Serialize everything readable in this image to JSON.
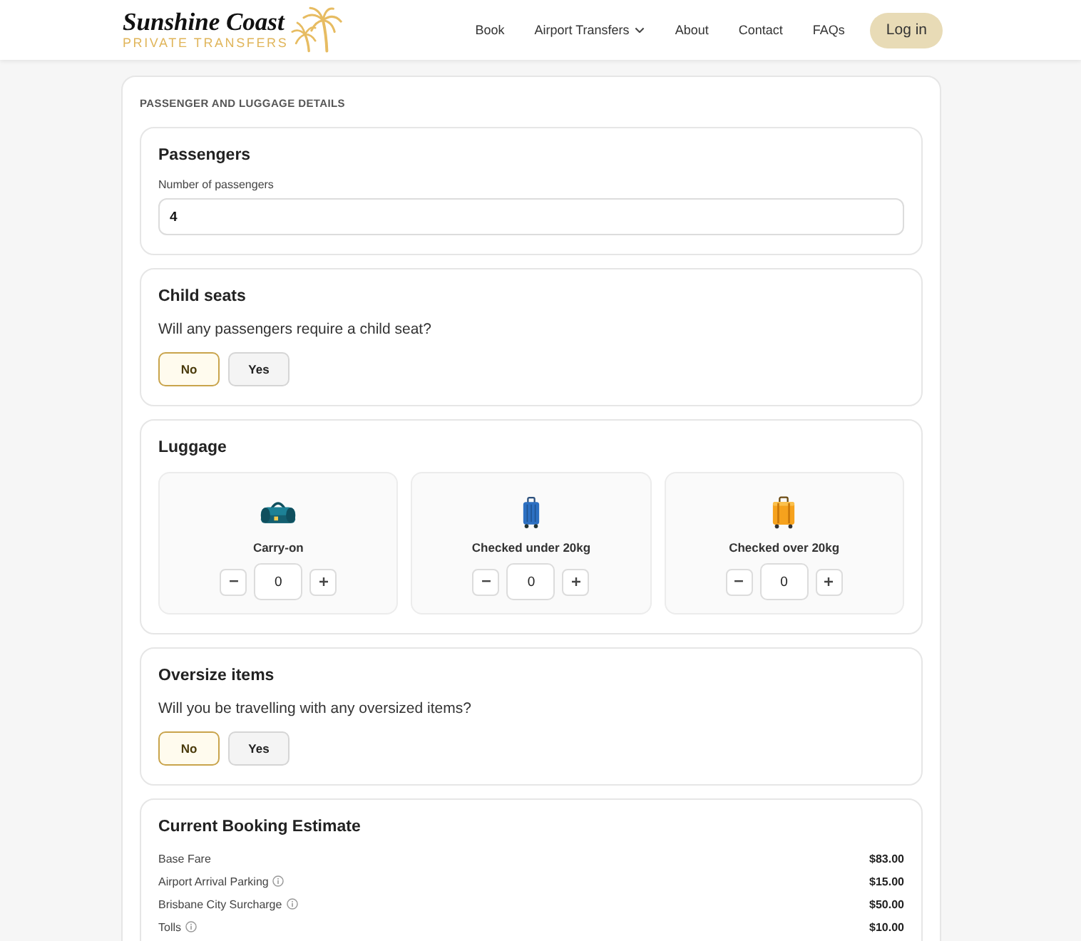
{
  "header": {
    "logo": {
      "title": "Sunshine Coast",
      "subtitle": "PRIVATE TRANSFERS"
    },
    "nav": [
      {
        "label": "Book",
        "has_dropdown": false
      },
      {
        "label": "Airport Transfers",
        "has_dropdown": true
      },
      {
        "label": "About",
        "has_dropdown": false
      },
      {
        "label": "Contact",
        "has_dropdown": false
      },
      {
        "label": "FAQs",
        "has_dropdown": false
      }
    ],
    "login_button": "Log in"
  },
  "form": {
    "heading": "PASSENGER AND LUGGAGE DETAILS",
    "sections": [
      {
        "kind": "number_field",
        "title": "Passengers",
        "field_label": "Number of passengers",
        "value": "4"
      },
      {
        "kind": "choice",
        "title": "Child seats",
        "question": "Will any passengers require a child seat?",
        "options": [
          {
            "label": "No",
            "selected": true
          },
          {
            "label": "Yes",
            "selected": false
          }
        ]
      },
      {
        "kind": "luggage",
        "title": "Luggage",
        "items": [
          {
            "kind": "carry_on",
            "label": "Carry-on",
            "value": "0"
          },
          {
            "kind": "checked_light",
            "label": "Checked under 20kg",
            "value": "0"
          },
          {
            "kind": "checked_heavy",
            "label": "Checked over 20kg",
            "value": "0"
          }
        ]
      },
      {
        "kind": "choice",
        "title": "Oversize items",
        "question": "Will you be travelling with any oversized items?",
        "options": [
          {
            "label": "No",
            "selected": true
          },
          {
            "label": "Yes",
            "selected": false
          }
        ]
      },
      {
        "kind": "estimate",
        "title": "Current Booking Estimate",
        "rows": [
          {
            "label": "Base Fare",
            "info": false,
            "amount": "$83.00"
          },
          {
            "label": "Airport Arrival Parking",
            "info": true,
            "amount": "$15.00"
          },
          {
            "label": "Brisbane City Surcharge",
            "info": true,
            "amount": "$50.00"
          },
          {
            "label": "Tolls",
            "info": true,
            "amount": "$10.00"
          }
        ]
      }
    ]
  }
}
